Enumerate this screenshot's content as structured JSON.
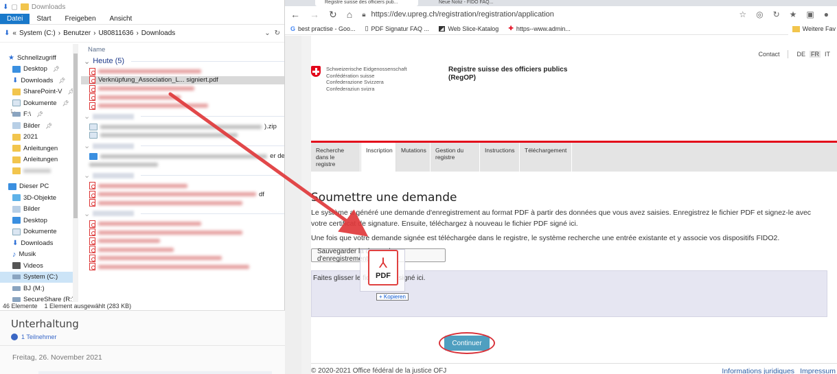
{
  "explorer": {
    "title": "Downloads",
    "ribbon_tabs": [
      "Datei",
      "Start",
      "Freigeben",
      "Ansicht"
    ],
    "path": [
      "System (C:)",
      "Benutzer",
      "U80811636",
      "Downloads"
    ],
    "nav_items": [
      {
        "label": "Schnellzugriff",
        "icon": "star-icon",
        "top": true
      },
      {
        "label": "Desktop",
        "icon": "desktop-icon"
      },
      {
        "label": "Downloads",
        "icon": "download-icon"
      },
      {
        "label": "SharePoint-V",
        "icon": "folder-icon"
      },
      {
        "label": "Dokumente",
        "icon": "document-icon"
      },
      {
        "label": "F:\\",
        "icon": "drive-icon"
      },
      {
        "label": "Bilder",
        "icon": "picture-icon"
      },
      {
        "label": "2021",
        "icon": "folder-icon"
      },
      {
        "label": "Anleitungen",
        "icon": "folder-icon"
      },
      {
        "label": "Anleitungen",
        "icon": "folder-icon"
      },
      {
        "label": "",
        "icon": "folder-icon"
      },
      {
        "label": "Dieser PC",
        "icon": "computer-icon",
        "top": true
      },
      {
        "label": "3D-Objekte",
        "icon": "cube-icon"
      },
      {
        "label": "Bilder",
        "icon": "picture-icon"
      },
      {
        "label": "Desktop",
        "icon": "desktop-icon"
      },
      {
        "label": "Dokumente",
        "icon": "document-icon"
      },
      {
        "label": "Downloads",
        "icon": "download-icon"
      },
      {
        "label": "Musik",
        "icon": "music-icon"
      },
      {
        "label": "Videos",
        "icon": "video-icon"
      },
      {
        "label": "System (C:)",
        "icon": "drive-icon"
      },
      {
        "label": "BJ (M:)",
        "icon": "drive-icon"
      },
      {
        "label": "SecureShare (R:)",
        "icon": "drive-icon"
      }
    ],
    "column_name": "Name",
    "group_today": "Heute (5)",
    "selected_file": "Verknüpfung_Association_L... signiert.pdf",
    "suffix_zip": ").zip",
    "suffix_der": "er der",
    "suffix_pdf": "df",
    "status_count": "46 Elemente",
    "status_selected": "1 Element ausgewählt (283 KB)"
  },
  "chat": {
    "title": "Unterhaltung",
    "participants": "1 Teilnehmer",
    "date": "Freitag, 26. November 2021"
  },
  "browser": {
    "tab1": "Registre suisse des officiers pub...",
    "tab2": "Neue Notiz - FIDO FAQ...",
    "url": "https://dev.upreg.ch/registration/registration/application",
    "bookmarks": [
      "best practise - Goo...",
      "PDF Signatur FAQ ...",
      "Web Slice-Katalog",
      "https--www.admin..."
    ],
    "bookmarks_more": "Weitere Fav"
  },
  "page": {
    "contact": "Contact",
    "langs": [
      "DE",
      "FR",
      "IT"
    ],
    "active_lang": "FR",
    "confed_lines": [
      "Schweizerische Eidgenossenschaft",
      "Confédération suisse",
      "Confederazione Svizzera",
      "Confederaziun svizra"
    ],
    "register_title": "Registre suisse des officiers publics",
    "register_abbr": "(RegOP)",
    "nav": [
      {
        "label": "Recherche dans le registre",
        "active": false
      },
      {
        "label": "Inscription",
        "active": true
      },
      {
        "label": "Mutations",
        "active": false
      },
      {
        "label": "Gestion du registre",
        "active": false
      },
      {
        "label": "Instructions",
        "active": false
      },
      {
        "label": "Téléchargement",
        "active": false
      }
    ],
    "heading": "Soumettre une demande",
    "para1": "Le système a généré une demande d'enregistrement au format PDF à partir des données que vous avez saisies. Enregistrez le fichier PDF et signez-le avec votre certificat de signature. Ensuite, téléchargez à nouveau le fichier PDF signé ici.",
    "para2": "Une fois que votre demande signée est téléchargée dans le registre, le système recherche une entrée existante et y associe vos dispositifs FIDO2.",
    "save_button": "Sauvegarder la demande d'enregistrement",
    "dropzone_text": "Faites glisser le fichier PDF signé ici.",
    "drag_label": "PDF",
    "copy_badge": "+ Kopieren",
    "continue_button": "Continuer",
    "footer_copy": "© 2020-2021 Office fédéral de la justice OFJ",
    "footer_links": [
      "Informations juridiques",
      "Impressum"
    ]
  },
  "colors": {
    "swiss_red": "#e3061a",
    "annotation_red": "#d8323a",
    "continue_blue": "#4f9fc0",
    "dropzone": "#e6e6f2",
    "link_blue": "#2a5ba3"
  }
}
